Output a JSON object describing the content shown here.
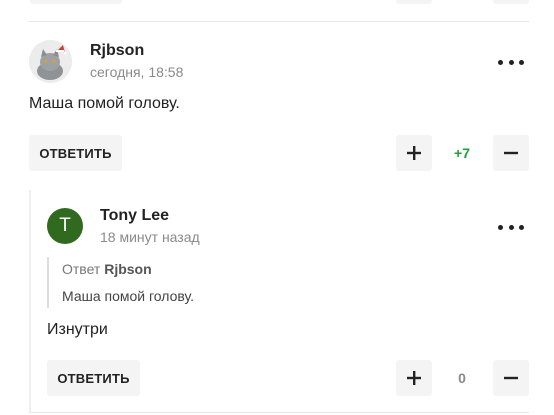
{
  "comments": [
    {
      "username": "Rjbson",
      "timestamp": "сегодня, 18:58",
      "text": "Маша помой голову.",
      "reply_label": "ОТВЕТИТЬ",
      "score": "+7",
      "score_color": "#1aa33a",
      "avatar_icon": "cat-with-santa-hat"
    },
    {
      "username": "Tony Lee",
      "avatar_letter": "T",
      "avatar_color": "#2f6a1f",
      "timestamp": "18 минут назад",
      "quote": {
        "prefix": "Ответ",
        "author": "Rjbson",
        "text": "Маша помой голову."
      },
      "text": "Изнутри",
      "reply_label": "ОТВЕТИТЬ",
      "score": "0",
      "score_color": "#8a8a8a"
    }
  ]
}
